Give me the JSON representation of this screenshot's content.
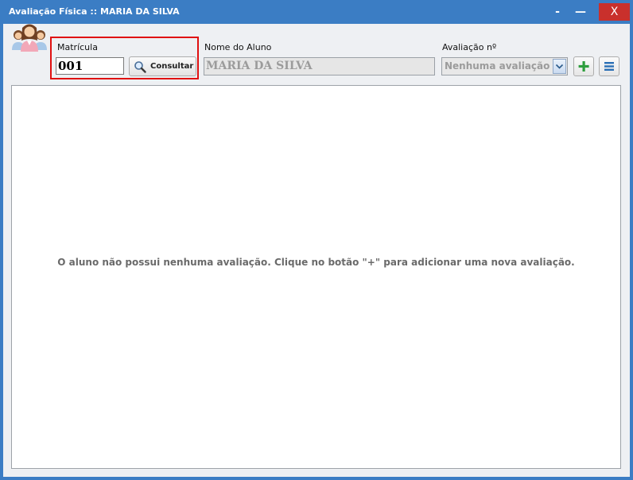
{
  "window": {
    "title": "Avaliação Física  ::  MARIA DA SILVA",
    "minimize_glyph": "-",
    "maximize_glyph": "—",
    "close_glyph": "X"
  },
  "form": {
    "matricula_label": "Matrícula",
    "matricula_value": "001",
    "consultar_label": "Consultar",
    "nome_label": "Nome do Aluno",
    "nome_value": "MARIA DA SILVA",
    "avaliacao_label": "Avaliação nº",
    "avaliacao_selected": "Nenhuma avaliação"
  },
  "panel": {
    "empty_message": "O aluno não possui nenhuma avaliação. Clique no botão \"+\" para adicionar uma nova avaliação."
  },
  "icons": {
    "avatar": "users-group-icon",
    "search": "magnifier-icon",
    "add": "plus-icon",
    "menu": "hamburger-menu-icon",
    "dropdown": "chevron-down-icon"
  },
  "colors": {
    "titlebar": "#3b7dc4",
    "close_button": "#c9302c",
    "highlight_border": "#e01010",
    "add_icon": "#2e9e3e",
    "menu_icon": "#2a6fb5"
  }
}
